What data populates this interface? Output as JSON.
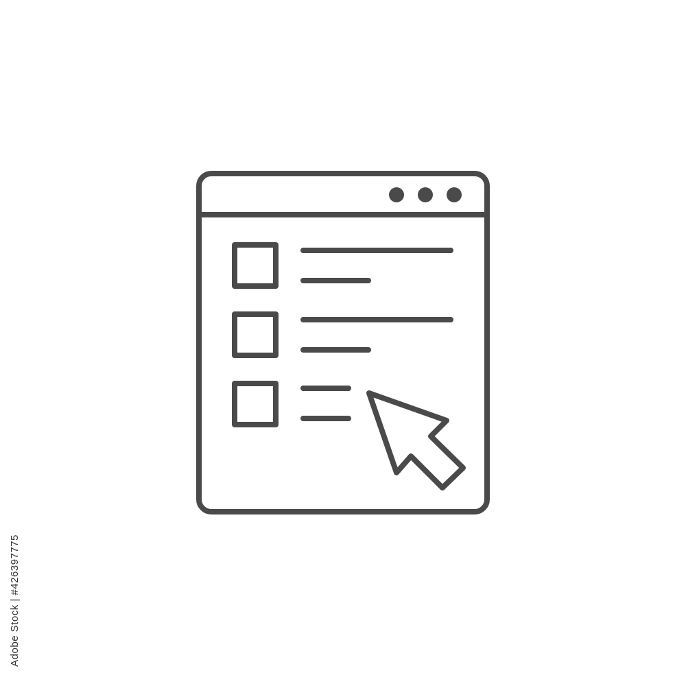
{
  "colors": {
    "background": "#ffffff",
    "stroke": "#4a4a4a",
    "watermark_text": "#333333"
  },
  "icon": {
    "name": "checklist-window-cursor-icon",
    "window_controls": [
      "window-dot-icon",
      "window-dot-icon",
      "window-dot-icon"
    ],
    "checklist_item_count": 3,
    "cursor": "arrow-cursor-icon"
  },
  "watermark": {
    "id_text": "Adobe Stock | #426397775"
  }
}
